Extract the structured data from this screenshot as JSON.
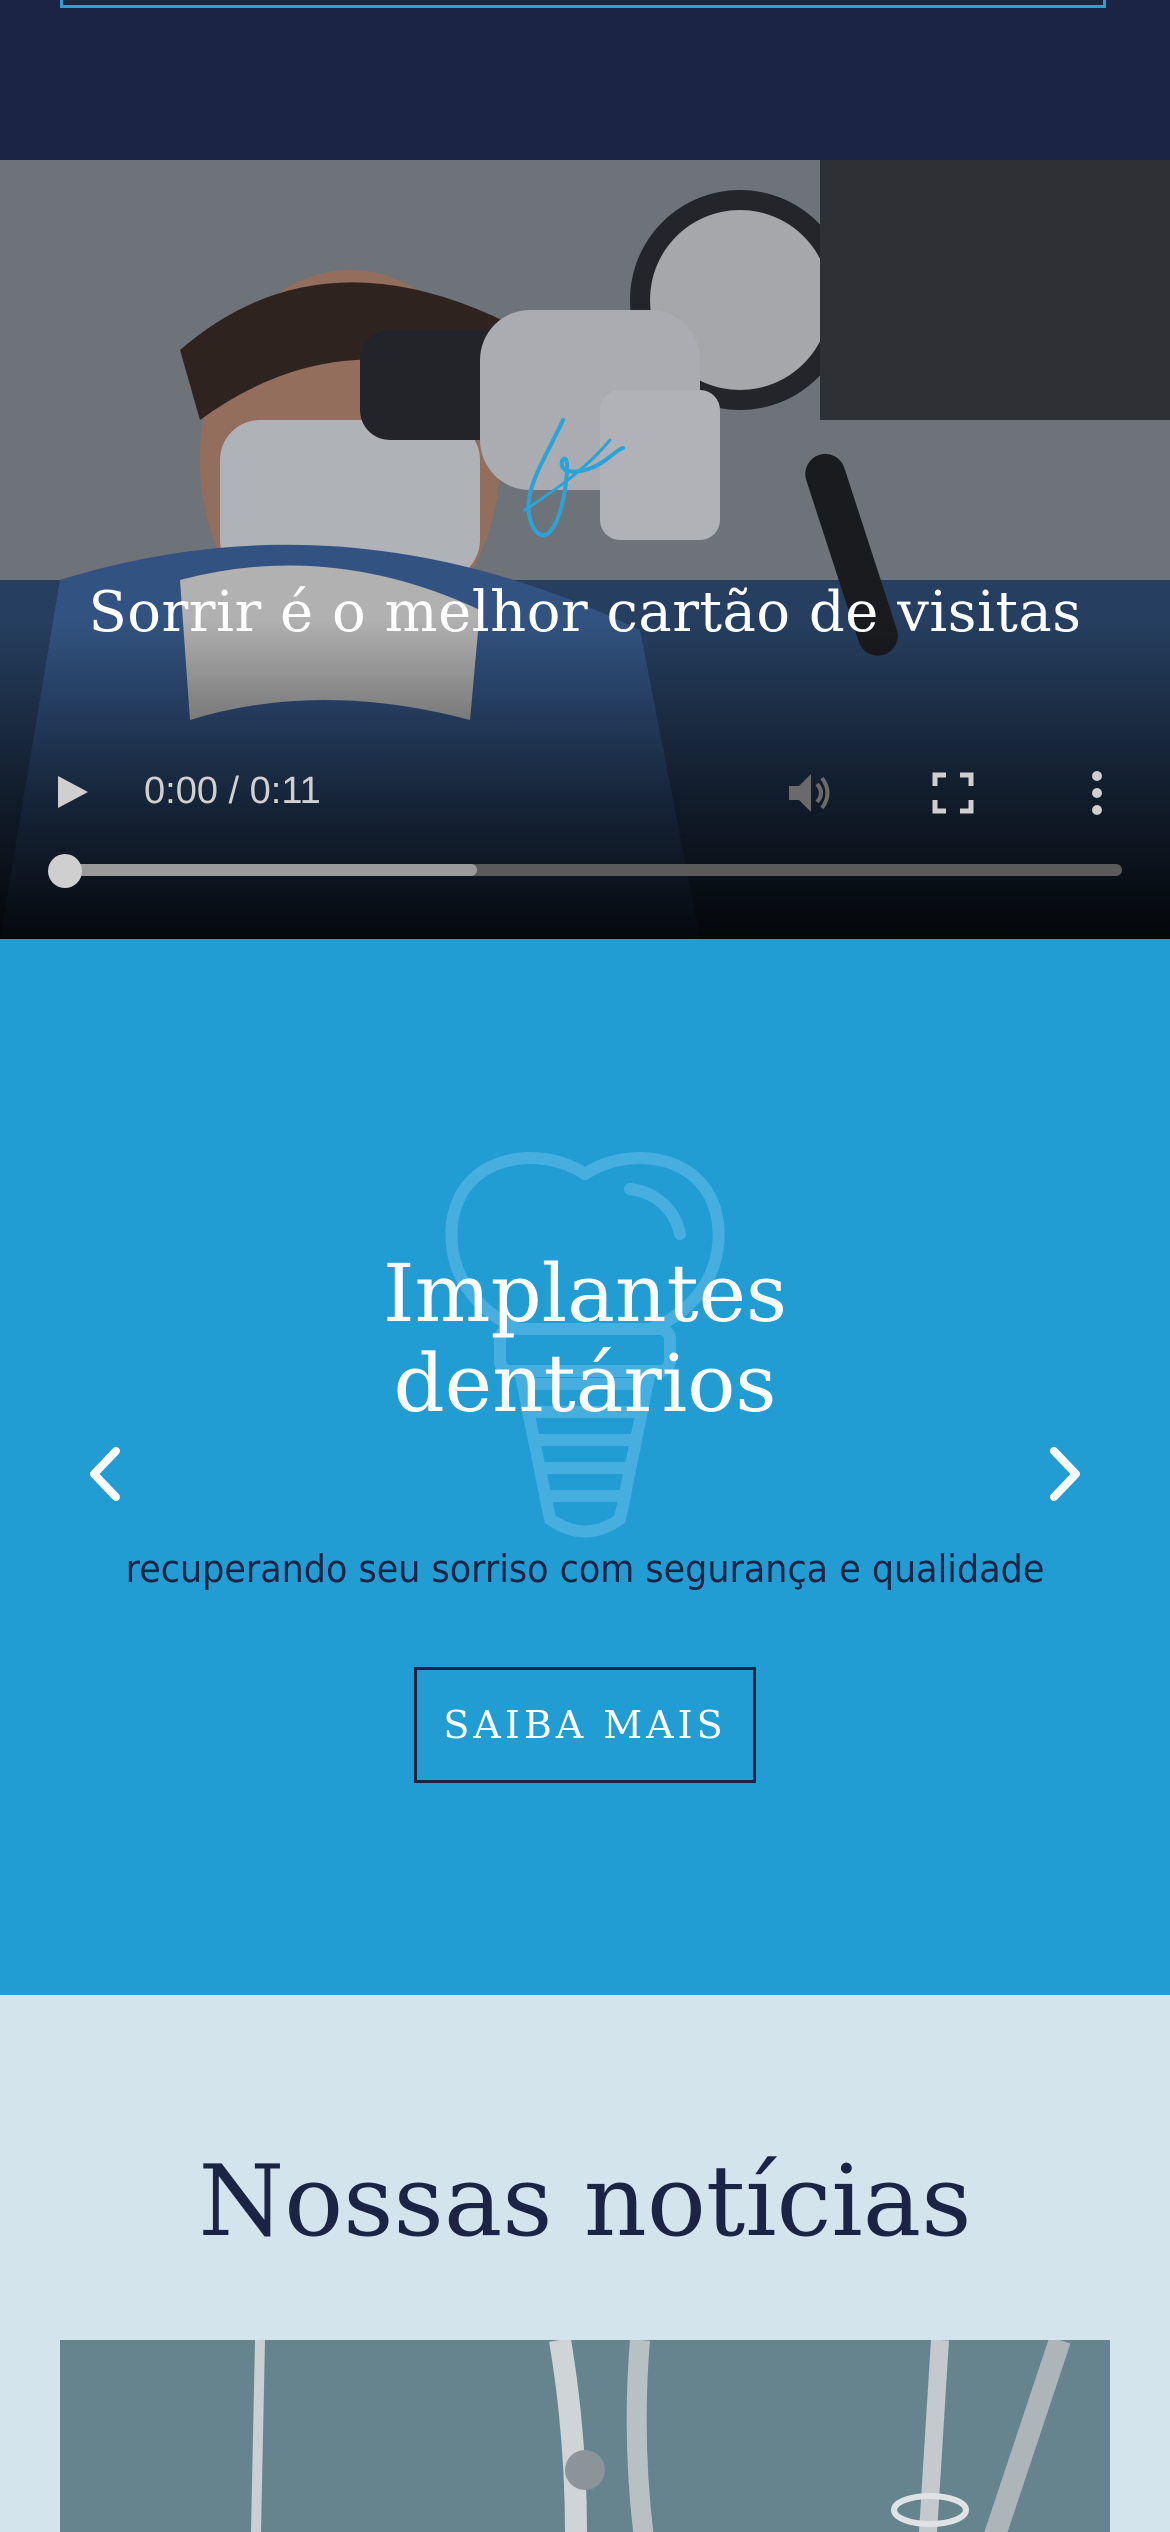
{
  "video": {
    "tagline": "Sorrir é o melhor cartão de visitas",
    "time_display": "0:00 / 0:11",
    "buffered_fraction": 0.39,
    "icons": [
      "play-icon",
      "volume-icon",
      "fullscreen-icon",
      "more-options-icon"
    ]
  },
  "slider": {
    "title_line1": "Implantes",
    "title_line2": "dentários",
    "subtitle": "recuperando seu sorriso com segurança e qualidade",
    "cta_label": "SAIBA MAIS",
    "background_color": "#229dd4",
    "icons": [
      "arrow-left-icon",
      "arrow-right-icon",
      "tooth-implant-icon"
    ]
  },
  "news": {
    "title": "Nossas notícias"
  },
  "colors": {
    "navy": "#1b2444",
    "accent_blue": "#229dd4",
    "light_blue": "#d3e4ed"
  }
}
